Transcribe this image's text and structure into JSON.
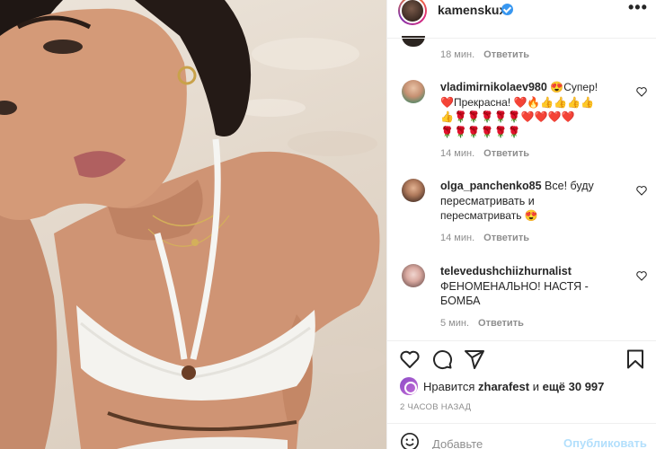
{
  "post": {
    "username": "kamenskux"
  },
  "first_meta": {
    "time": "18 мин.",
    "reply": "Ответить"
  },
  "comments": [
    {
      "username": "vladimirnikolaev980",
      "line1_rest": "😍Супер!",
      "line2": "❤️Прекрасна! ❤️🔥👍👍👍👍",
      "line3": "👍🌹🌹🌹🌹🌹❤️❤️❤️❤️",
      "line4": "🌹🌹🌹🌹🌹🌹",
      "time": "14 мин.",
      "reply": "Ответить"
    },
    {
      "username": "olga_panchenko85",
      "line1_rest": "Все! буду",
      "line2": "пересматривать и",
      "line3": "пересматривать 😍",
      "time": "14 мин.",
      "reply": "Ответить"
    },
    {
      "username": "televedushchiizhurnalist",
      "line2": "ФЕНОМЕНАЛЬНО! НАСТЯ -",
      "line3": "БОМБА",
      "time": "5 мин.",
      "reply": "Ответить"
    }
  ],
  "likes": {
    "prefix": "Нравится",
    "user": "zharafest",
    "middle": "и",
    "count": "ещё 30 997"
  },
  "date": "2 ЧАСОВ НАЗАД",
  "add_comment": {
    "placeholder": "Добавьте",
    "post_label": "Опубликовать"
  },
  "colors": {
    "accent": "#3897f0",
    "post_disabled": "#b2dffc",
    "heart_red": "#ed4956"
  },
  "icons": [
    "more-icon",
    "verified-icon",
    "like-icon",
    "comment-icon",
    "share-icon",
    "save-icon",
    "emoji-icon"
  ]
}
